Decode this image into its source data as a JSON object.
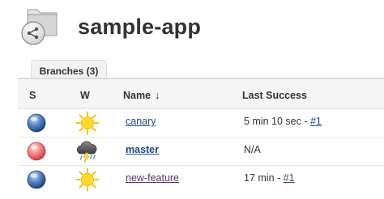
{
  "header": {
    "title": "sample-app",
    "icon": "folder-pipeline-icon"
  },
  "tabs": [
    {
      "label": "Branches (3)",
      "active": true
    }
  ],
  "table": {
    "columns": {
      "status": "S",
      "weather": "W",
      "name": "Name",
      "name_sort": "↓",
      "last_success": "Last Success"
    },
    "rows": [
      {
        "status": "blue-ball-icon",
        "weather": "sunny-icon",
        "name": "canary",
        "last_success_text": "5 min 10 sec - ",
        "last_success_build": "#1"
      },
      {
        "status": "red-ball-icon",
        "weather": "thunderstorm-icon",
        "name": "master",
        "last_success_text": "N/A",
        "last_success_build": ""
      },
      {
        "status": "blue-ball-icon",
        "weather": "sunny-icon",
        "name": "new-feature",
        "last_success_text": "17 min - ",
        "last_success_build": "#1"
      }
    ]
  },
  "colors": {
    "blue_ball": "#3465a4",
    "red_ball": "#ef2929",
    "link": "#204a87",
    "visited_link": "#5c3566"
  }
}
